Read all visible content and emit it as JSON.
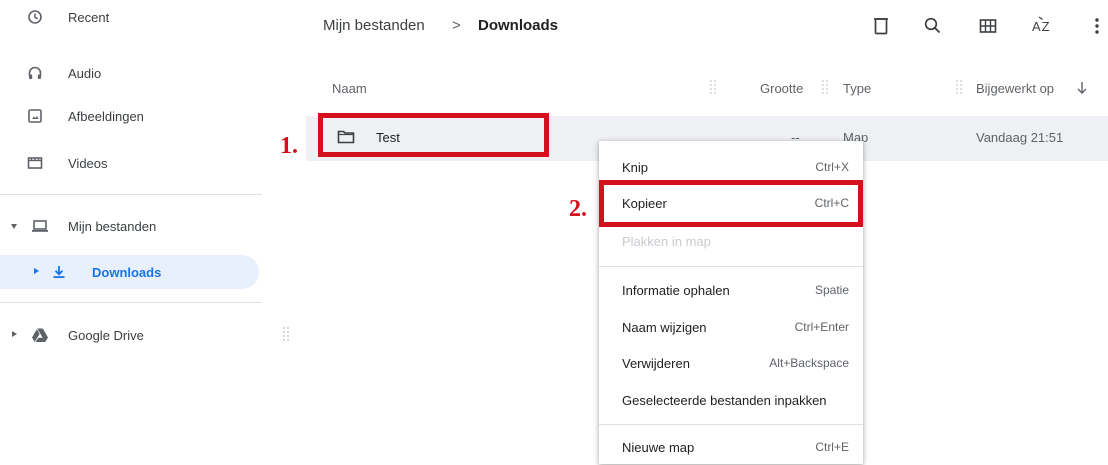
{
  "sidebar": {
    "recent": "Recent",
    "audio": "Audio",
    "images": "Afbeeldingen",
    "videos": "Videos",
    "my_files": "Mijn bestanden",
    "downloads": "Downloads",
    "google_drive": "Google Drive"
  },
  "breadcrumb": {
    "root": "Mijn bestanden",
    "separator": ">",
    "current": "Downloads"
  },
  "toolbar": {
    "icons": [
      "delete-icon",
      "search-icon",
      "grid-view-icon",
      "sort-icon",
      "more-icon"
    ],
    "sort_label": "AZ"
  },
  "table": {
    "headers": {
      "name": "Naam",
      "size": "Grootte",
      "type": "Type",
      "modified": "Bijgewerkt op"
    },
    "rows": [
      {
        "name": "Test",
        "size": "--",
        "type": "Map",
        "modified": "Vandaag 21:51"
      }
    ]
  },
  "annotations": {
    "step1": "1.",
    "step2": "2.",
    "color": "#d3101c"
  },
  "context_menu": {
    "items": [
      {
        "label": "Knip",
        "shortcut": "Ctrl+X",
        "enabled": true
      },
      {
        "label": "Kopieer",
        "shortcut": "Ctrl+C",
        "enabled": true
      },
      {
        "label": "Plakken in map",
        "shortcut": "",
        "enabled": false
      },
      {
        "label": "Informatie ophalen",
        "shortcut": "Spatie",
        "enabled": true
      },
      {
        "label": "Naam wijzigen",
        "shortcut": "Ctrl+Enter",
        "enabled": true
      },
      {
        "label": "Verwijderen",
        "shortcut": "Alt+Backspace",
        "enabled": true
      },
      {
        "label": "Geselecteerde bestanden inpakken",
        "shortcut": "",
        "enabled": true
      },
      {
        "label": "Nieuwe map",
        "shortcut": "Ctrl+E",
        "enabled": true
      }
    ]
  },
  "colors": {
    "accent": "#1a73e8",
    "selected_nav_bg": "#e8f0fe",
    "selected_row_bg": "#eef0f3"
  }
}
